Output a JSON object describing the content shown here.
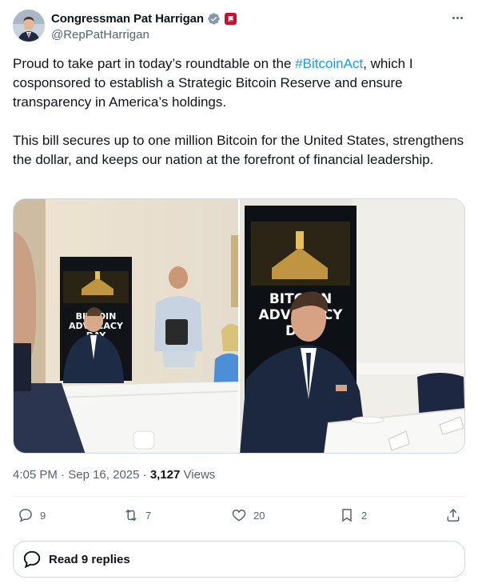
{
  "author": {
    "display_name": "Congressman Pat Harrigan",
    "handle": "@RepPatHarrigan",
    "verified_badge": "verified-check-icon",
    "affiliation_badge": "government-flag-icon"
  },
  "tweet": {
    "text_part1": "Proud to take part in today’s roundtable on the ",
    "hashtag": "#BitcoinAct",
    "text_part2": ", which I cosponsored to establish a Strategic Bitcoin Reserve and ensure transparency in America’s holdings.",
    "paragraph2": "This bill secures up to one million Bitcoin for the United States, strengthens the dollar, and keeps our nation at the forefront of financial leadership."
  },
  "media": {
    "left_banner_lines": [
      "BITCOIN",
      "ADVOCACY",
      "DAY"
    ],
    "right_banner_lines": [
      "BITCOIN",
      "ADVOCACY",
      "DAY"
    ]
  },
  "meta": {
    "time": "4:05 PM",
    "date": "Sep 16, 2025",
    "views_count": "3,127",
    "views_label": "Views"
  },
  "actions": {
    "replies": "9",
    "reposts": "7",
    "likes": "20",
    "bookmarks": "2"
  },
  "read_replies": "Read 9 replies",
  "colors": {
    "accent": "#1d9bf0",
    "text": "#0f1419",
    "secondary": "#536471",
    "border": "#cfd9de"
  }
}
